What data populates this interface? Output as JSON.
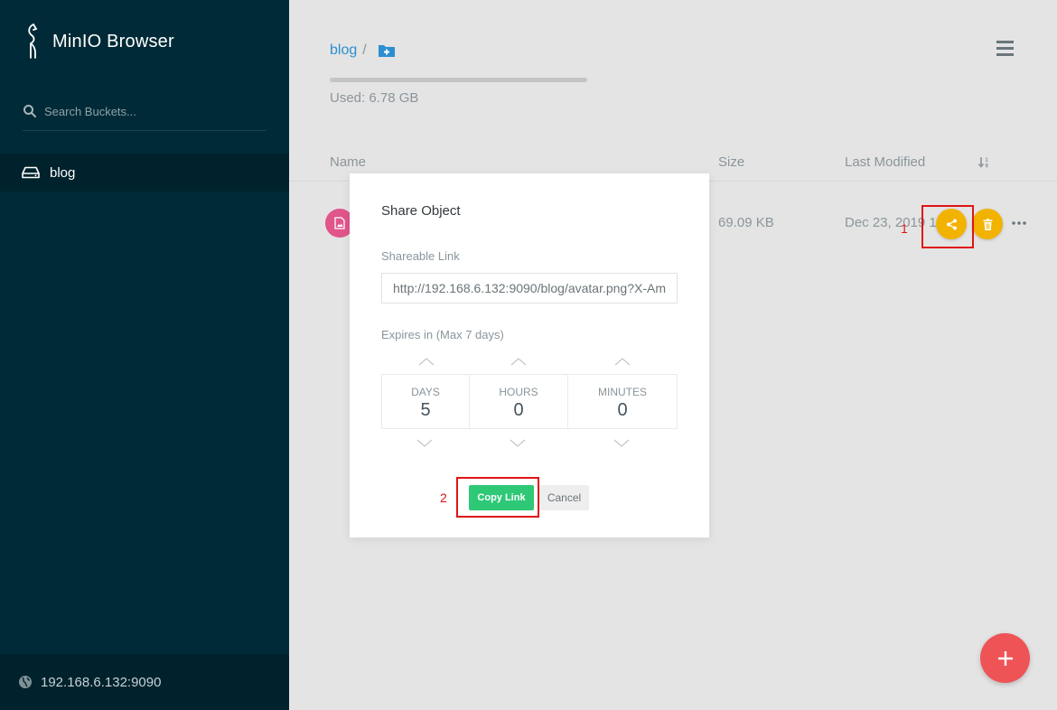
{
  "app": {
    "name": "MinIO Browser"
  },
  "sidebar": {
    "search_placeholder": "Search Buckets...",
    "buckets": [
      {
        "label": "blog"
      }
    ],
    "host": "192.168.6.132:9090"
  },
  "main": {
    "breadcrumb": {
      "bucket": "blog",
      "separator": "/"
    },
    "storage": {
      "used_text": "Used: 6.78 GB",
      "bar_fraction": 1.0
    },
    "columns": {
      "name": "Name",
      "size": "Size",
      "modified": "Last Modified"
    },
    "files": [
      {
        "size": "69.09 KB",
        "modified": "Dec 23, 2019 1"
      }
    ],
    "icons": {
      "add_folder": "folder-plus-icon",
      "menu": "hamburger-menu-icon",
      "sort": "sort-icon",
      "share": "share-icon",
      "delete": "trash-icon",
      "more": "more-icon",
      "fab": "plus-icon"
    }
  },
  "modal": {
    "title": "Share Object",
    "link_label": "Shareable Link",
    "link_value": "http://192.168.6.132:9090/blog/avatar.png?X-Amz-A",
    "expiry_label": "Expires in (Max 7 days)",
    "expiry": [
      {
        "label": "DAYS",
        "value": "5"
      },
      {
        "label": "HOURS",
        "value": "0"
      },
      {
        "label": "MINUTES",
        "value": "0"
      }
    ],
    "copy_label": "Copy Link",
    "cancel_label": "Cancel"
  },
  "annotations": {
    "share_step": "1",
    "copy_step": "2"
  },
  "colors": {
    "sidebar": "#002a37",
    "sidebar_active": "#00222d",
    "background": "#e4e4e4",
    "link": "#2b8fd0",
    "action": "#f2b200",
    "file_thumb": "#e0558a",
    "fab": "#ee5356",
    "copy_button": "#2ec877",
    "annotation": "#e01515"
  }
}
